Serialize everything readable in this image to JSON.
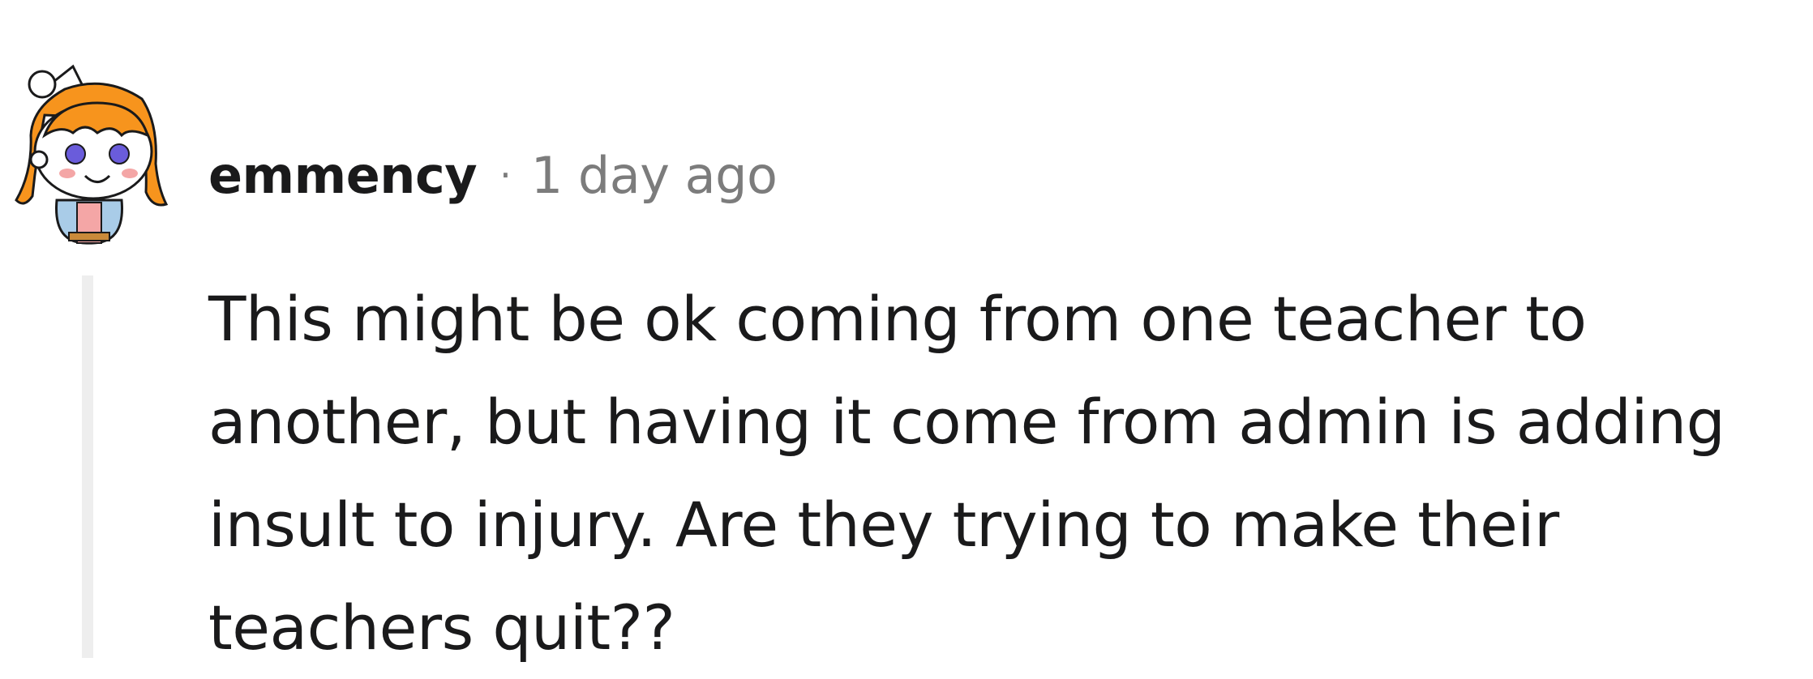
{
  "comment": {
    "author": "emmency",
    "separator": "·",
    "time_ago": "1 day ago",
    "body_lines": [
      "This might be ok coming from one teacher to",
      "another, but having it come from admin is adding",
      "insult to injury. Are they trying to make their",
      "teachers quit??"
    ]
  },
  "colors": {
    "text": "#1a1a1b",
    "meta": "#7c7c7c",
    "thread_line": "#eeeeee",
    "avatar_hair": "#f7941d",
    "avatar_eyes": "#6a5cdb",
    "avatar_jacket": "#a9cce8",
    "avatar_shirt": "#f4a6a6"
  },
  "icons": {
    "avatar": "snoo-avatar-icon"
  }
}
